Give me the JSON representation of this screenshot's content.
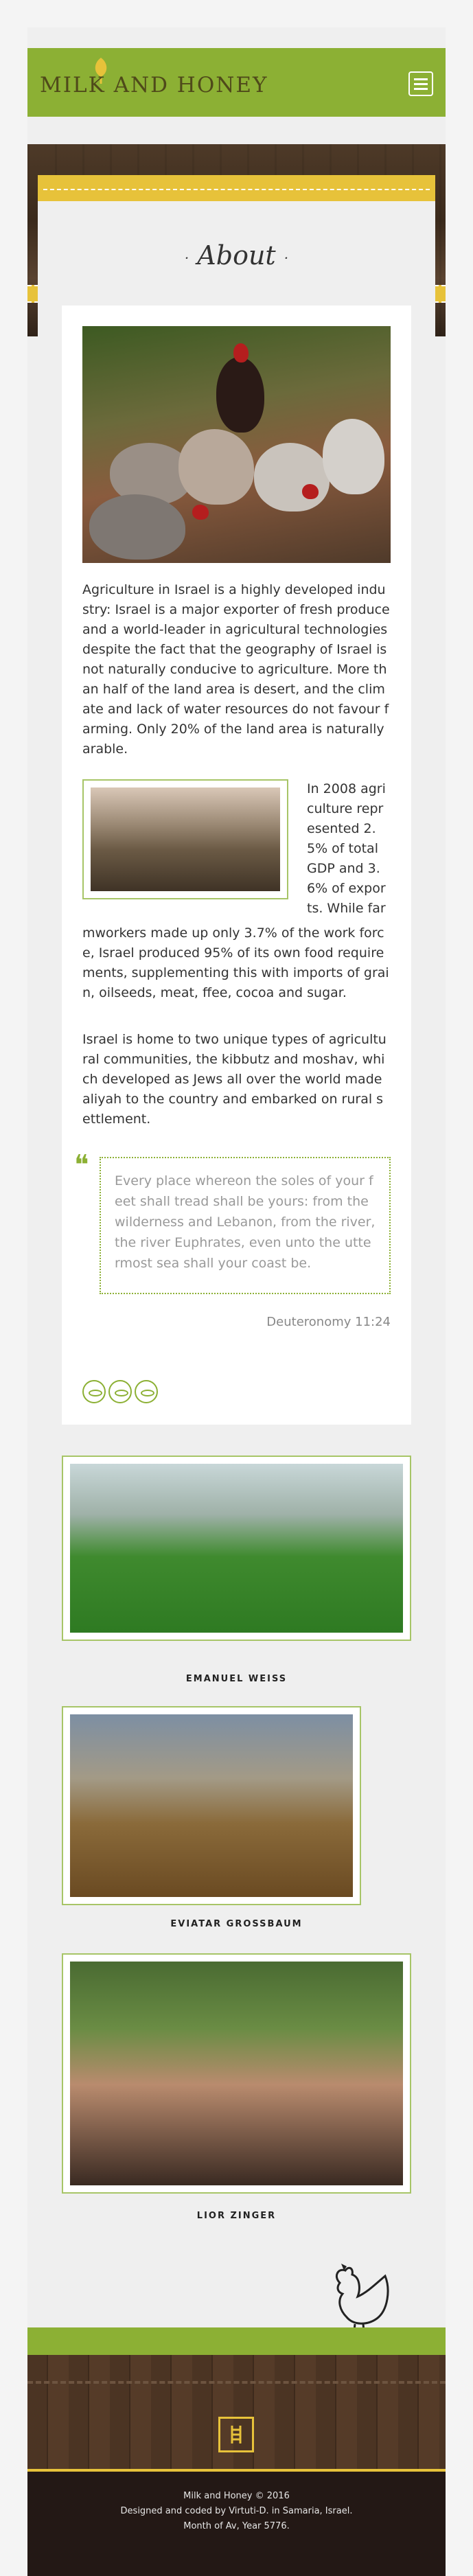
{
  "header": {
    "logo_text": "MILK AND HONEY",
    "menu_icon": "hamburger-icon"
  },
  "about": {
    "title": "About",
    "dot": "·",
    "para1": "Agriculture in Israel is a highly developed industry: Israel is a major exporter of fresh produce and a world-leader in agricultural technologies despite the fact that the geography of Israel is not naturally conducive to agriculture. More than half of the land area is desert, and the climate and lack of water resources do not favour farming. Only 20% of the land area is naturally arable.",
    "para2_side": "In 2008 agriculture represented 2.5% of total GDP and 3.6% of exports. While far",
    "para2_rest": "mworkers made up only 3.7% of the work force, Israel produced 95% of its own food requirements, supplementing this with imports of grain, oilseeds, meat, ffee, cocoa and sugar.",
    "para3": "Israel is home to two unique types of agricultural communities, the kibbutz and moshav, which developed as Jews all over the world made aliyah to the country and embarked on rural settlement.",
    "quote_mark": "❝",
    "quote": "Every place whereon the soles of your feet shall tread shall be yours: from the wilderness and Lebanon, from the river, the river Euphrates, even unto the uttermost sea shall your coast be.",
    "quote_cite": "Deuteronomy 11:24",
    "badges": [
      "eye-badge-icon",
      "eye-badge-icon",
      "eye-badge-icon"
    ]
  },
  "gallery": [
    {
      "caption": "EMANUEL WEISS"
    },
    {
      "caption": "EVIATAR GROSSBAUM"
    },
    {
      "caption": "LIOR ZINGER"
    }
  ],
  "footer": {
    "line1": "Milk and Honey © 2016",
    "line2": "Designed and coded by Virtuti-D. in Samaria, Israel.",
    "line3": "Month of Av, Year 5776."
  },
  "colors": {
    "brand_green": "#8cb034",
    "accent_yellow": "#e7c23a",
    "wood_dark": "#231815"
  }
}
